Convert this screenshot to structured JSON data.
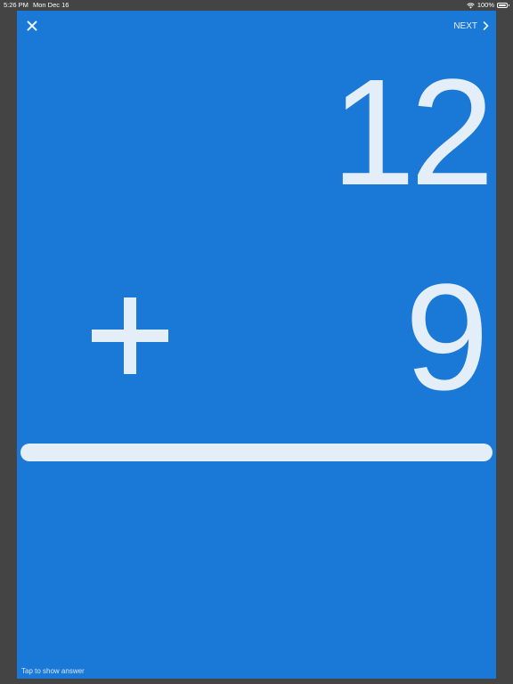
{
  "status_bar": {
    "time": "5:26 PM",
    "date": "Mon Dec 16",
    "battery": "100%",
    "wifi_icon": "wifi-icon",
    "battery_icon": "battery-icon"
  },
  "card": {
    "background": "#1a78d6",
    "close_icon": "close-icon",
    "next_label": "NEXT",
    "next_icon": "chevron-right-icon",
    "top_number": "12",
    "operator": "+",
    "bottom_number": "9",
    "hint": "Tap to show answer"
  }
}
